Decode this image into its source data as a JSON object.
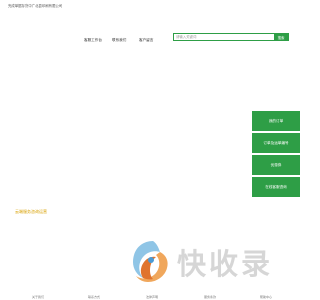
{
  "header": {
    "site_description": "完成单据存货中广北县印刷有限公司"
  },
  "nav": {
    "items": [
      {
        "label": "客服工作台"
      },
      {
        "label": "联系我们"
      },
      {
        "label": "客户留言"
      }
    ]
  },
  "search": {
    "placeholder": "请输入关键词",
    "button_label": "搜索"
  },
  "side_menu": {
    "items": [
      {
        "label": "我的订单"
      },
      {
        "label": "订单及运单编号"
      },
      {
        "label": "优惠券"
      },
      {
        "label": "在线客服咨询"
      }
    ]
  },
  "section": {
    "title": "云端服务咨询运营"
  },
  "watermark": {
    "text": "快收录"
  },
  "footer": {
    "items": [
      {
        "label": "关于我们"
      },
      {
        "label": "联系方式"
      },
      {
        "label": "法律声明"
      },
      {
        "label": "服务条款"
      },
      {
        "label": "帮助中心"
      }
    ]
  },
  "colors": {
    "accent": "#2e9e46",
    "section_title": "#d8a000",
    "watermark": "#d6d6d6"
  }
}
